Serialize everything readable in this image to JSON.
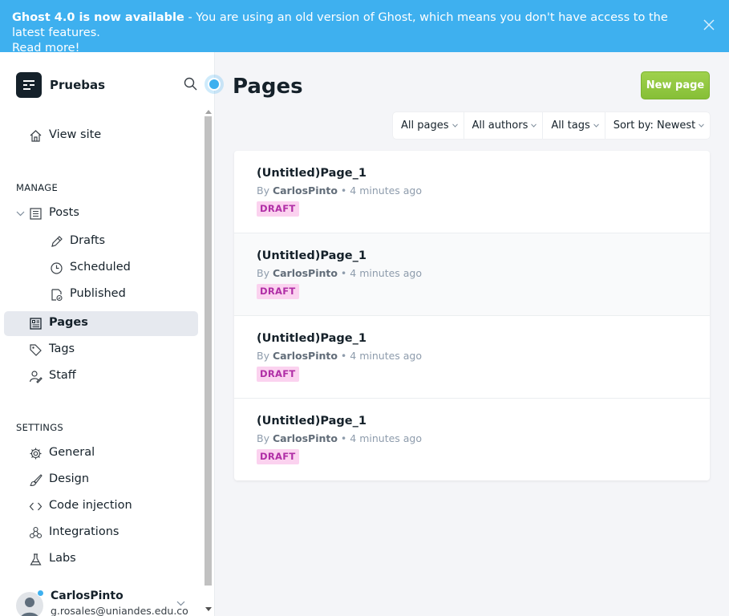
{
  "banner": {
    "headline": "Ghost 4.0 is now available",
    "message": " - You are using an old version of Ghost, which means you don't have access to the latest features. ",
    "link": "Read more!",
    "close_icon": "close-icon"
  },
  "sidebar": {
    "brand": "Pruebas",
    "view_site": "View site",
    "manage_title": "MANAGE",
    "posts": "Posts",
    "drafts": "Drafts",
    "scheduled": "Scheduled",
    "published": "Published",
    "pages": "Pages",
    "tags": "Tags",
    "staff": "Staff",
    "settings_title": "SETTINGS",
    "general": "General",
    "design": "Design",
    "code_injection": "Code injection",
    "integrations": "Integrations",
    "labs": "Labs"
  },
  "user": {
    "name": "CarlosPinto",
    "email": "g.rosales@uniandes.edu.co"
  },
  "main": {
    "title": "Pages",
    "new_button": "New page",
    "filters": [
      "All pages",
      "All authors",
      "All tags",
      "Sort by: Newest"
    ],
    "rows": [
      {
        "title": "(Untitled)Page_1",
        "by": "By ",
        "author": "CarlosPinto",
        "time": " • 4 minutes ago",
        "status": "DRAFT"
      },
      {
        "title": "(Untitled)Page_1",
        "by": "By ",
        "author": "CarlosPinto",
        "time": " • 4 minutes ago",
        "status": "DRAFT"
      },
      {
        "title": "(Untitled)Page_1",
        "by": "By ",
        "author": "CarlosPinto",
        "time": " • 4 minutes ago",
        "status": "DRAFT"
      },
      {
        "title": "(Untitled)Page_1",
        "by": "By ",
        "author": "CarlosPinto",
        "time": " • 4 minutes ago",
        "status": "DRAFT"
      }
    ]
  },
  "colors": {
    "banner": "#3eb0ef",
    "accent_green": "#8cc63f",
    "draft_bg": "#fbd2ef",
    "draft_text": "#b02ea6"
  }
}
